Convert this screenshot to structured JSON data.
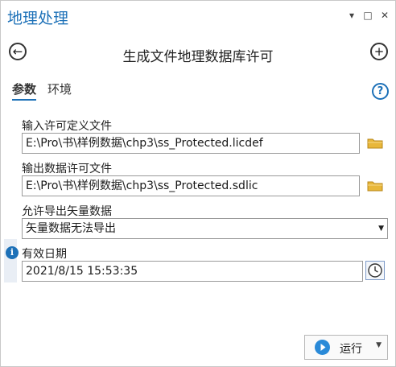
{
  "pane": {
    "title": "地理处理"
  },
  "window_controls": {
    "menu_icon": "▾",
    "restore_icon": "□",
    "close_icon": "✕"
  },
  "nav": {
    "back_icon": "arrow-left-icon",
    "tool_title": "生成文件地理数据库许可",
    "add_icon": "plus-icon"
  },
  "tabs": [
    {
      "label": "参数",
      "active": true
    },
    {
      "label": "环境",
      "active": false
    }
  ],
  "help": {
    "icon": "?"
  },
  "params": {
    "input_def": {
      "label": "输入许可定义文件",
      "value": "E:\\Pro\\书\\样例数据\\chp3\\ss_Protected.licdef"
    },
    "output_lic": {
      "label": "输出数据许可文件",
      "value": "E:\\Pro\\书\\样例数据\\chp3\\ss_Protected.sdlic"
    },
    "vector_export": {
      "label": "允许导出矢量数据",
      "value": "矢量数据无法导出"
    },
    "expiry": {
      "label": "有效日期",
      "value": "2021/8/15 15:53:35"
    }
  },
  "info": {
    "icon": "i"
  },
  "run": {
    "label": "运行"
  },
  "colors": {
    "accent": "#1d71b8",
    "folder": "#e8b73a"
  }
}
